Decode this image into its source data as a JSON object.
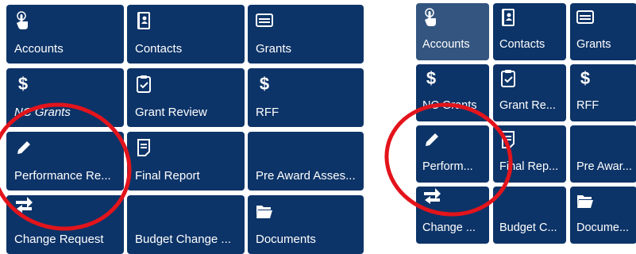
{
  "left_grid": {
    "tiles": [
      {
        "label": "Accounts",
        "icon": "touch-hand-icon"
      },
      {
        "label": "Contacts",
        "icon": "address-book-icon"
      },
      {
        "label": "Grants",
        "icon": "card-icon"
      },
      {
        "label": "NC Grants",
        "icon": "dollar-icon"
      },
      {
        "label": "Grant Review",
        "icon": "clipboard-check-icon"
      },
      {
        "label": "RFF",
        "icon": "dollar-icon"
      },
      {
        "label": "Performance Re...",
        "icon": "pencil-icon"
      },
      {
        "label": "Final Report",
        "icon": "document-icon"
      },
      {
        "label": "Pre Award Asses...",
        "icon": ""
      },
      {
        "label": "Change Request",
        "icon": "swap-arrows-icon"
      },
      {
        "label": "Budget Change ...",
        "icon": ""
      },
      {
        "label": "Documents",
        "icon": "folder-icon"
      }
    ]
  },
  "right_grid": {
    "tiles": [
      {
        "label": "Accounts",
        "icon": "touch-hand-icon"
      },
      {
        "label": "Contacts",
        "icon": "address-book-icon"
      },
      {
        "label": "Grants",
        "icon": "card-icon"
      },
      {
        "label": "NC Grants",
        "icon": "dollar-icon"
      },
      {
        "label": "Grant Re...",
        "icon": "clipboard-check-icon"
      },
      {
        "label": "RFF",
        "icon": "dollar-icon"
      },
      {
        "label": "Perform...",
        "icon": "pencil-icon"
      },
      {
        "label": "Final Rep...",
        "icon": "document-icon"
      },
      {
        "label": "Pre Awar...",
        "icon": ""
      },
      {
        "label": "Change ...",
        "icon": "swap-arrows-icon"
      },
      {
        "label": "Budget C...",
        "icon": ""
      },
      {
        "label": "Docume...",
        "icon": "folder-icon"
      }
    ]
  },
  "colors": {
    "tile_bg": "#0d3468",
    "tile_selected_bg": "#33557f",
    "annotation": "#e3141c"
  }
}
